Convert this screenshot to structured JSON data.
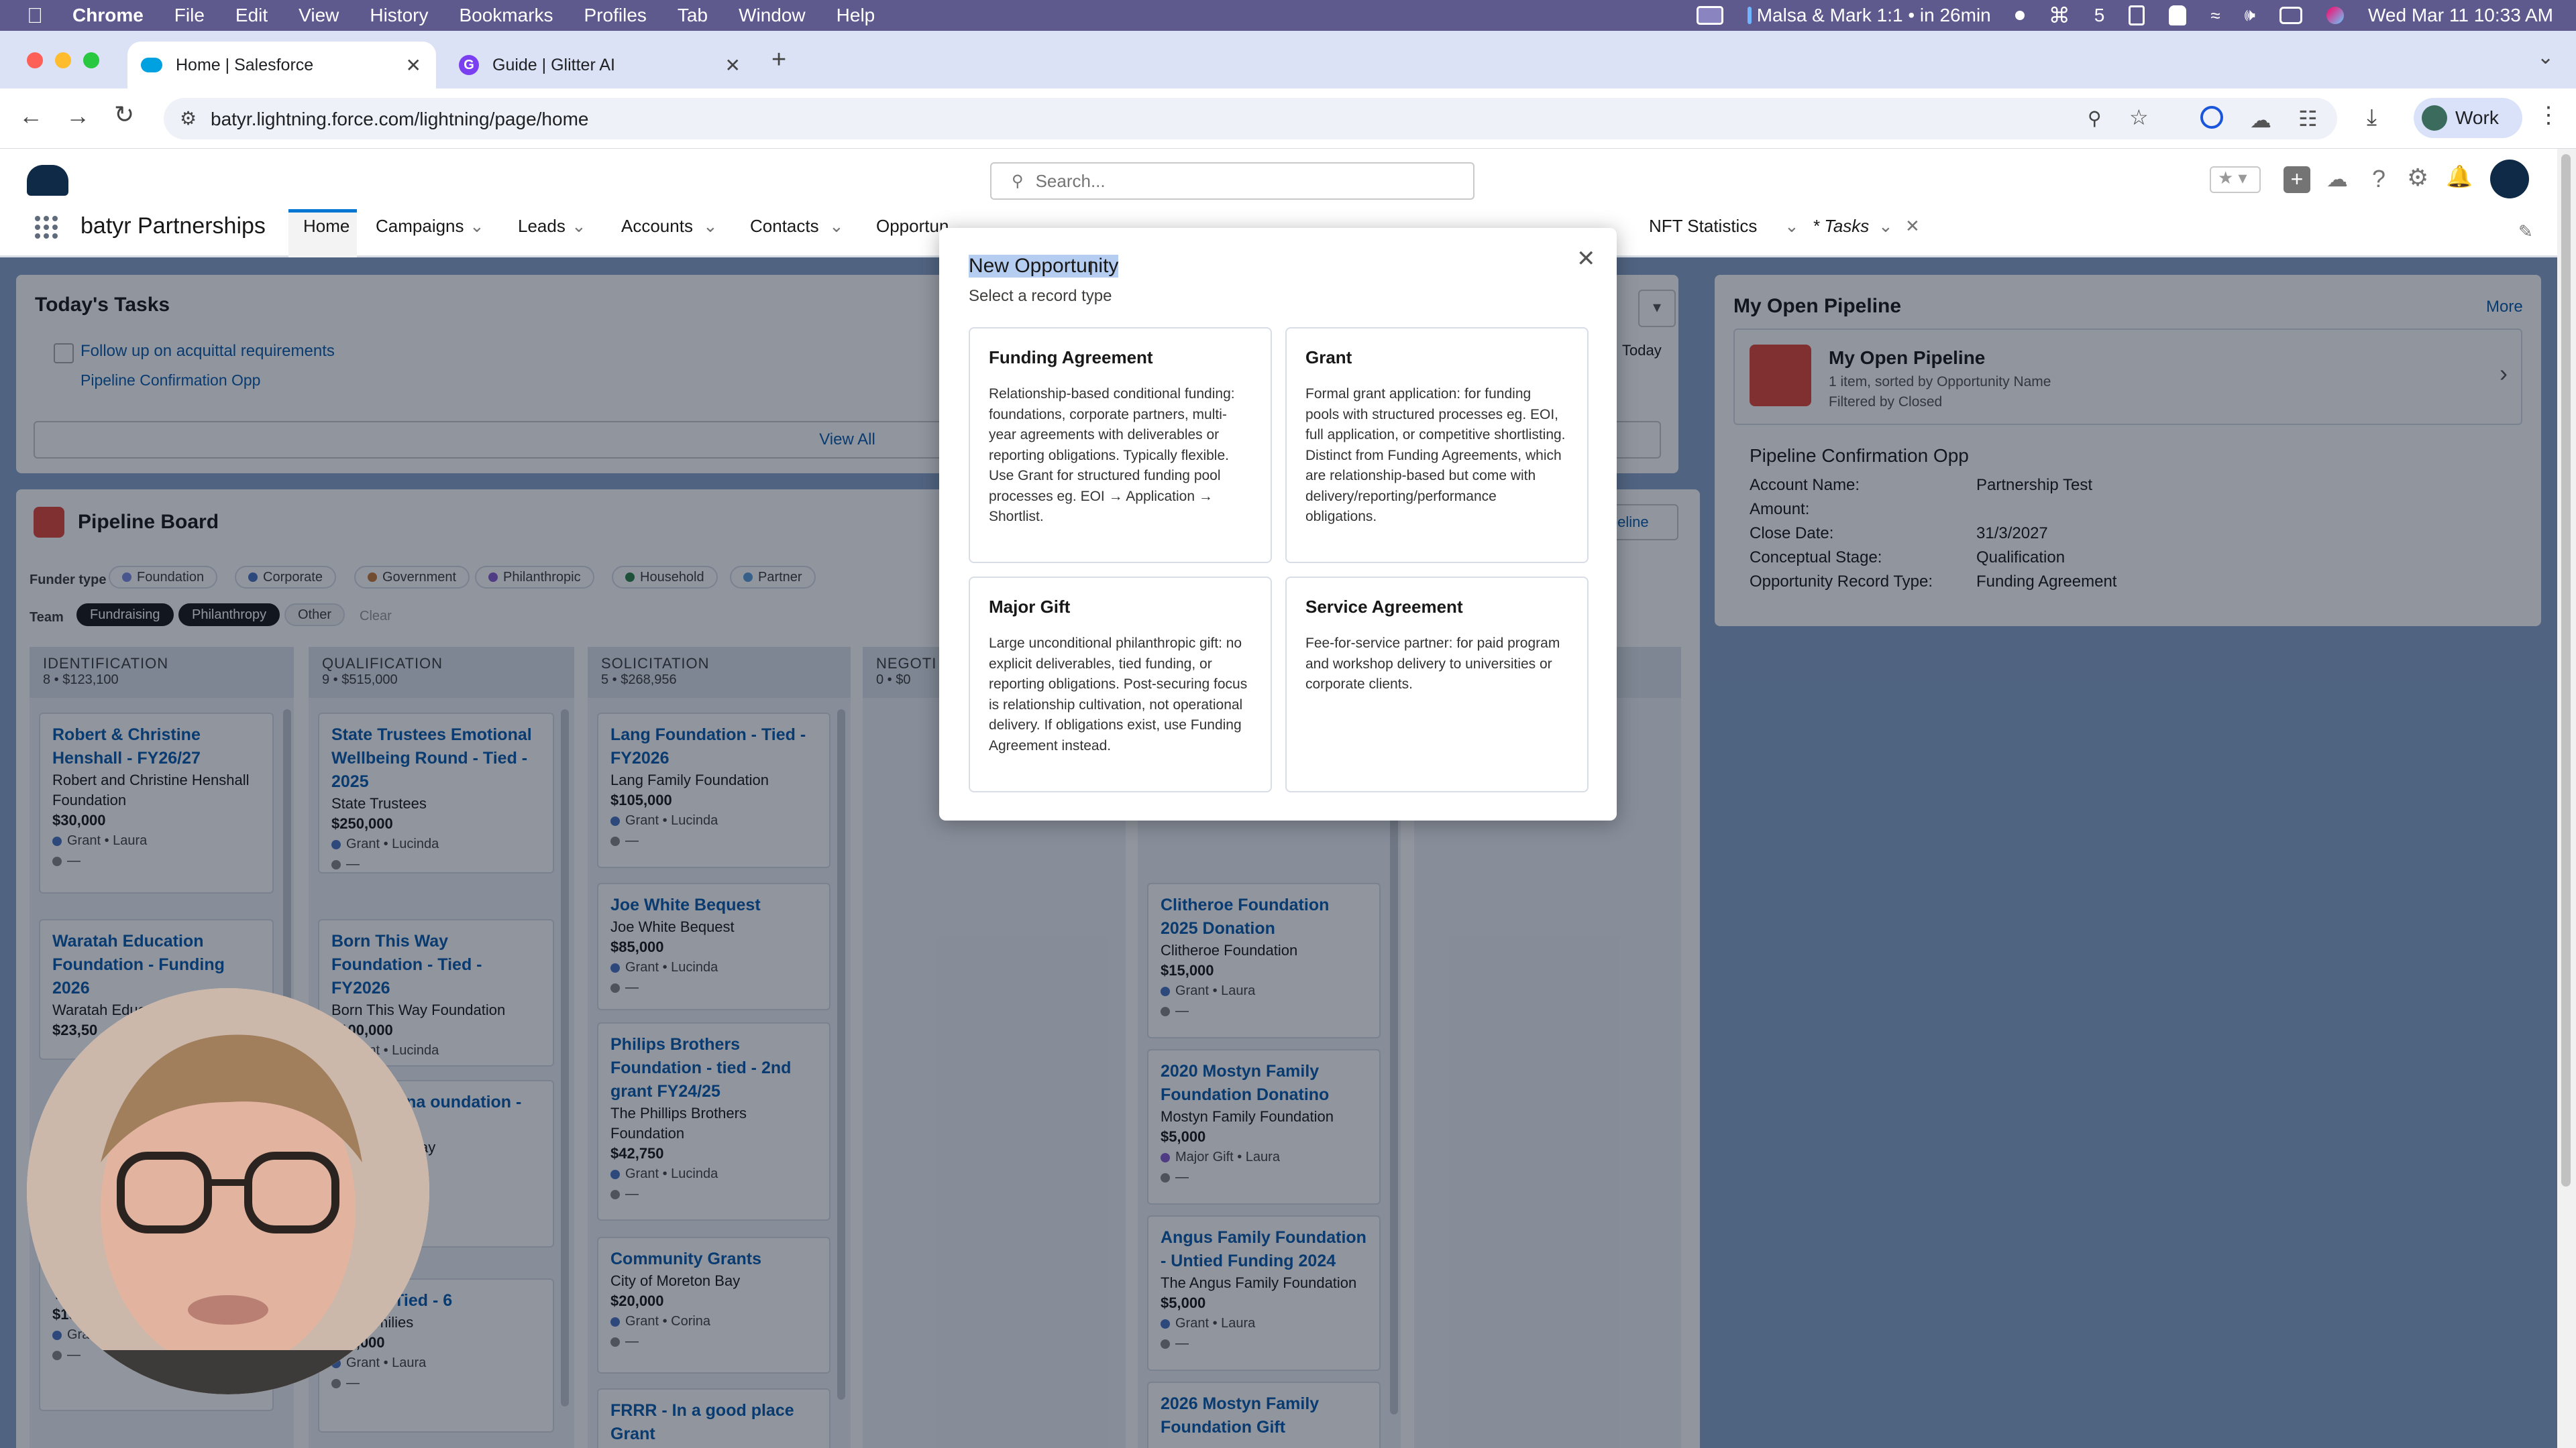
{
  "menubar": {
    "app": "Chrome",
    "items": [
      "File",
      "Edit",
      "View",
      "History",
      "Bookmarks",
      "Profiles",
      "Tab",
      "Window",
      "Help"
    ],
    "meeting": "Malsa & Mark 1:1 • in 26min",
    "badge_count": "5",
    "datetime": "Wed Mar 11  10:33 AM"
  },
  "browser": {
    "tabs": [
      {
        "title": "Home | Salesforce"
      },
      {
        "title": "Guide | Glitter AI"
      }
    ],
    "url": "batyr.lightning.force.com/lightning/page/home",
    "profile": "Work"
  },
  "sf": {
    "search_placeholder": "Search...",
    "app_name": "batyr Partnerships",
    "nav": [
      "Home",
      "Campaigns",
      "Leads",
      "Accounts",
      "Contacts",
      "Opportun",
      "NFT Statistics",
      "* Tasks"
    ],
    "tasks": {
      "title": "Today's Tasks",
      "task": "Follow up on acquittal requirements",
      "related": "Pipeline Confirmation Opp",
      "view_all": "View All",
      "today": "Today"
    },
    "board": {
      "title": "Pipeline Board",
      "funder_label": "Funder type",
      "funders": [
        {
          "name": "Foundation",
          "color": "#7f8de1"
        },
        {
          "name": "Corporate",
          "color": "#4b74c0"
        },
        {
          "name": "Government",
          "color": "#c97a3a"
        },
        {
          "name": "Philanthropic",
          "color": "#8a5bd1"
        },
        {
          "name": "Household",
          "color": "#2e844a"
        },
        {
          "name": "Partner",
          "color": "#5c9fd6"
        }
      ],
      "team_label": "Team",
      "teams": [
        "Fundraising",
        "Philanthropy",
        "Other"
      ],
      "clear": "Clear",
      "pipeline_btn": "ipeline",
      "columns": [
        {
          "name": "IDENTIFICATION",
          "summary": "8 • $123,100"
        },
        {
          "name": "QUALIFICATION",
          "summary": "9 • $515,000"
        },
        {
          "name": "SOLICITATION",
          "summary": "5 • $268,956"
        },
        {
          "name": "NEGOTI",
          "summary": "0 • $0"
        }
      ],
      "col1": [
        {
          "title": "Robert & Christine Henshall - FY26/27",
          "org": "Robert and Christine Henshall Foundation",
          "amount": "$30,000",
          "meta": "Grant • Laura"
        },
        {
          "title": "Waratah Education Foundation - Funding 2026",
          "org": "Waratah Education Foundation",
          "amount": "$23,50",
          "meta": ""
        },
        {
          "title": "F",
          "org": "The Foundat",
          "amount": "$19,600",
          "meta": "Grant • Laura"
        }
      ],
      "col2": [
        {
          "title": "State Trustees Emotional Wellbeing Round - Tied - 2025",
          "org": "State Trustees",
          "amount": "$250,000",
          "meta": "Grant • Lucinda"
        },
        {
          "title": "Born This Way Foundation - Tied - FY2026",
          "org": "Born This Way Foundation",
          "amount": "$100,000",
          "meta": "Grant • Lucinda"
        },
        {
          "title": "s and Diana oundation - Tied",
          "org": "l Diana Ramsay",
          "amount": "",
          "meta": ""
        },
        {
          "title": "milies - Tied - 6",
          "org": "nity Families",
          "amount": "$50,000",
          "meta": "Grant • Laura"
        }
      ],
      "col3": [
        {
          "title": "Lang Foundation - Tied - FY2026",
          "org": "Lang Family Foundation",
          "amount": "$105,000",
          "meta": "Grant • Lucinda"
        },
        {
          "title": "Joe White Bequest",
          "org": "Joe White Bequest",
          "amount": "$85,000",
          "meta": "Grant • Lucinda"
        },
        {
          "title": "Philips Brothers Foundation - tied - 2nd grant FY24/25",
          "org": "The Phillips Brothers Foundation",
          "amount": "$42,750",
          "meta": "Grant • Lucinda"
        },
        {
          "title": "Community Grants",
          "org": "City of Moreton Bay",
          "amount": "$20,000",
          "meta": "Grant • Corina"
        },
        {
          "title": "FRRR - In a good place Grant",
          "org": "",
          "amount": "",
          "meta": ""
        }
      ],
      "col5": [
        {
          "title": "",
          "org": "",
          "amount": "",
          "meta": "Grant • Laura"
        },
        {
          "title": "Clitheroe Foundation 2025 Donation",
          "org": "Clitheroe Foundation",
          "amount": "$15,000",
          "meta": "Grant • Laura"
        },
        {
          "title": "2020 Mostyn Family Foundation Donatino",
          "org": "Mostyn Family Foundation",
          "amount": "$5,000",
          "meta": "Major Gift • Laura"
        },
        {
          "title": "Angus Family Foundation - Untied Funding 2024",
          "org": "The Angus Family Foundation",
          "amount": "$5,000",
          "meta": "Grant • Laura"
        },
        {
          "title": "2026 Mostyn Family Foundation Gift",
          "org": "",
          "amount": "",
          "meta": ""
        }
      ]
    },
    "pipeline": {
      "title": "My Open Pipeline",
      "more": "More",
      "list_title": "My Open Pipeline",
      "list_sub1": "1 item, sorted by Opportunity Name",
      "list_sub2": "Filtered by Closed",
      "opp_name": "Pipeline Confirmation Opp",
      "fields": [
        {
          "label": "Account Name:",
          "value": "Partnership Test"
        },
        {
          "label": "Amount:",
          "value": ""
        },
        {
          "label": "Close Date:",
          "value": "31/3/2027"
        },
        {
          "label": "Conceptual Stage:",
          "value": "Qualification"
        },
        {
          "label": "Opportunity Record Type:",
          "value": "Funding Agreement"
        }
      ]
    }
  },
  "modal": {
    "title": "New Opportunity",
    "subtitle": "Select a record type",
    "types": [
      {
        "name": "Funding Agreement",
        "desc": "Relationship-based conditional funding: foundations, corporate partners, multi-year agreements with deliverables or reporting obligations. Typically flexible. Use Grant for structured funding pool processes eg. EOI → Application → Shortlist."
      },
      {
        "name": "Grant",
        "desc": "Formal grant application: for funding pools with structured processes eg. EOI, full application, or competitive shortlisting. Distinct from Funding Agreements, which are relationship-based but come with delivery/reporting/performance obligations."
      },
      {
        "name": "Major Gift",
        "desc": "Large unconditional philanthropic gift: no explicit deliverables, tied funding, or reporting obligations. Post-securing focus is relationship cultivation, not operational delivery. If obligations exist, use Funding Agreement instead."
      },
      {
        "name": "Service Agreement",
        "desc": "Fee-for-service partner: for paid program and workshop delivery to universities or corporate clients."
      }
    ]
  }
}
